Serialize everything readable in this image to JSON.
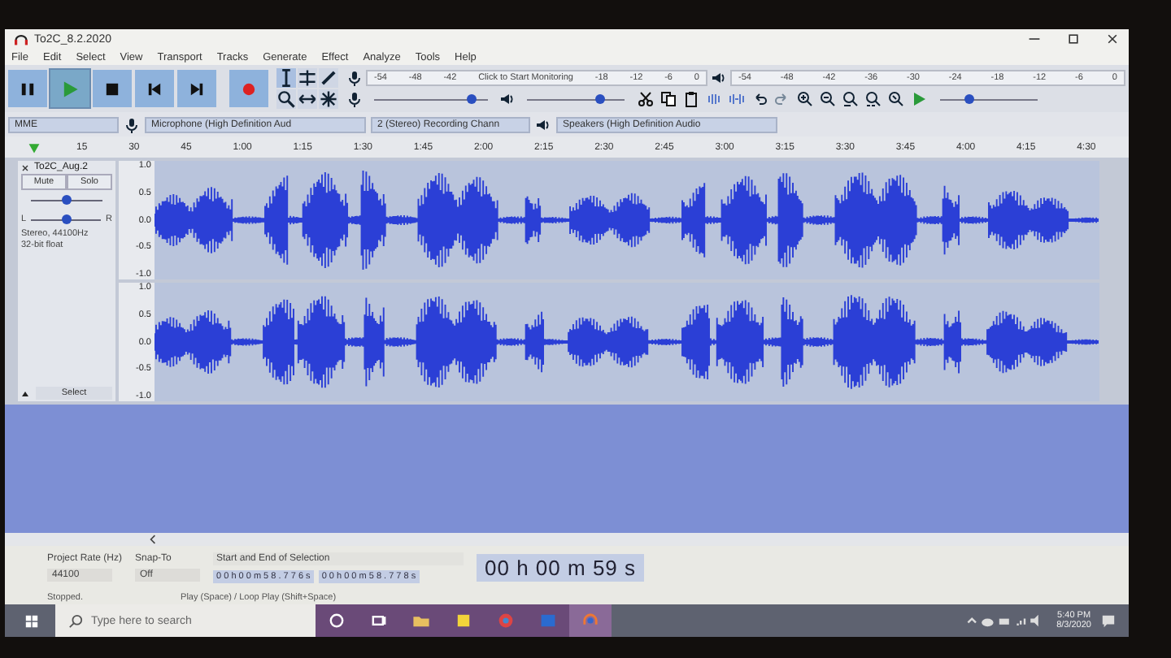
{
  "window": {
    "title": "To2C_8.2.2020"
  },
  "menu": [
    "File",
    "Edit",
    "Select",
    "View",
    "Transport",
    "Tracks",
    "Generate",
    "Effect",
    "Analyze",
    "Tools",
    "Help"
  ],
  "record_meter": {
    "ticks": [
      "-54",
      "-48",
      "-42",
      "Click to Start Monitoring",
      "-18",
      "-12",
      "-6",
      "0"
    ]
  },
  "playback_meter": {
    "ticks": [
      "-54",
      "-48",
      "-42",
      "-36",
      "-30",
      "-24",
      "-18",
      "-12",
      "-6",
      "0"
    ]
  },
  "record_volume": {
    "level": 0.85
  },
  "playback_volume": {
    "level": 0.75
  },
  "play_speed": {
    "level": 0.3
  },
  "devices": {
    "host": "MME",
    "microphone": "Microphone (High Definition Aud",
    "channels": "2 (Stereo) Recording Chann",
    "speakers": "Speakers (High Definition Audio"
  },
  "timeline": [
    "15",
    "30",
    "45",
    "1:00",
    "1:15",
    "1:30",
    "1:45",
    "2:00",
    "2:15",
    "2:30",
    "2:45",
    "3:00",
    "3:15",
    "3:30",
    "3:45",
    "4:00",
    "4:15",
    "4:30"
  ],
  "track": {
    "name": "To2C_Aug.2",
    "mute": "Mute",
    "solo": "Solo",
    "gain": {
      "level": 0.5
    },
    "pan": {
      "level": 0.5
    },
    "pan_left": "L",
    "pan_right": "R",
    "info": [
      "Stereo, 44100Hz",
      "32-bit float"
    ],
    "select": "Select",
    "channels": [
      {
        "scale": [
          "1.0",
          "0.5",
          "0.0",
          "-0.5",
          "-1.0"
        ]
      },
      {
        "scale": [
          "1.0",
          "0.5",
          "0.0",
          "-0.5",
          "-1.0"
        ]
      }
    ]
  },
  "selection_bar": {
    "rate_label": "Project Rate (Hz)",
    "rate": "44100",
    "snap_label": "Snap-To",
    "snap": "Off",
    "selection_label": "Start and End of Selection",
    "start": "0 0 h 0 0 m 5 8 . 7 7 6 s",
    "end": "0 0 h 0 0 m 5 8 . 7 7 8 s",
    "time": "00 h 00 m 59 s"
  },
  "status_bar": {
    "state": "Stopped.",
    "hint": "Play (Space) / Loop Play (Shift+Space)"
  },
  "taskbar": {
    "search_placeholder": "Type here to search",
    "time": "5:40 PM",
    "date": "8/3/2020"
  }
}
